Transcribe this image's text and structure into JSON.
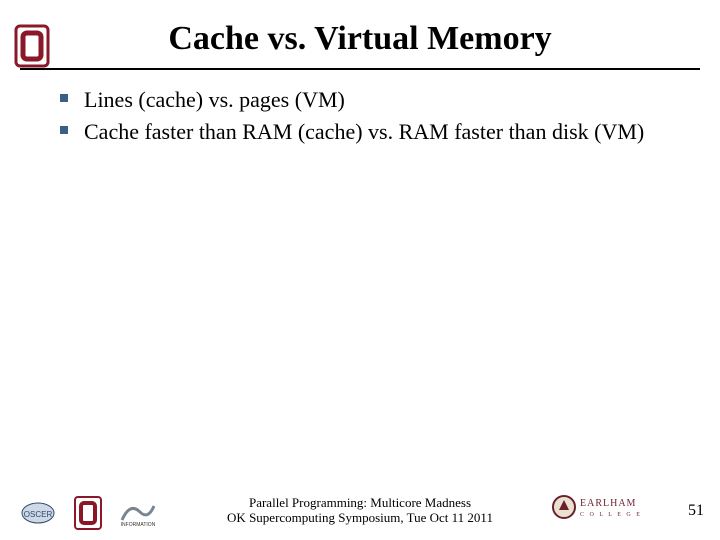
{
  "title": "Cache vs. Virtual Memory",
  "bullets": [
    "Lines (cache) vs. pages (VM)",
    "Cache faster than RAM (cache) vs. RAM faster than disk (VM)"
  ],
  "footer": {
    "line1": "Parallel Programming: Multicore Madness",
    "line2": "OK Supercomputing Symposium, Tue Oct 11 2011"
  },
  "page_number": "51",
  "brand": {
    "ou_crimson": "#8a1828",
    "earlham_maroon": "#6d1f2f"
  }
}
